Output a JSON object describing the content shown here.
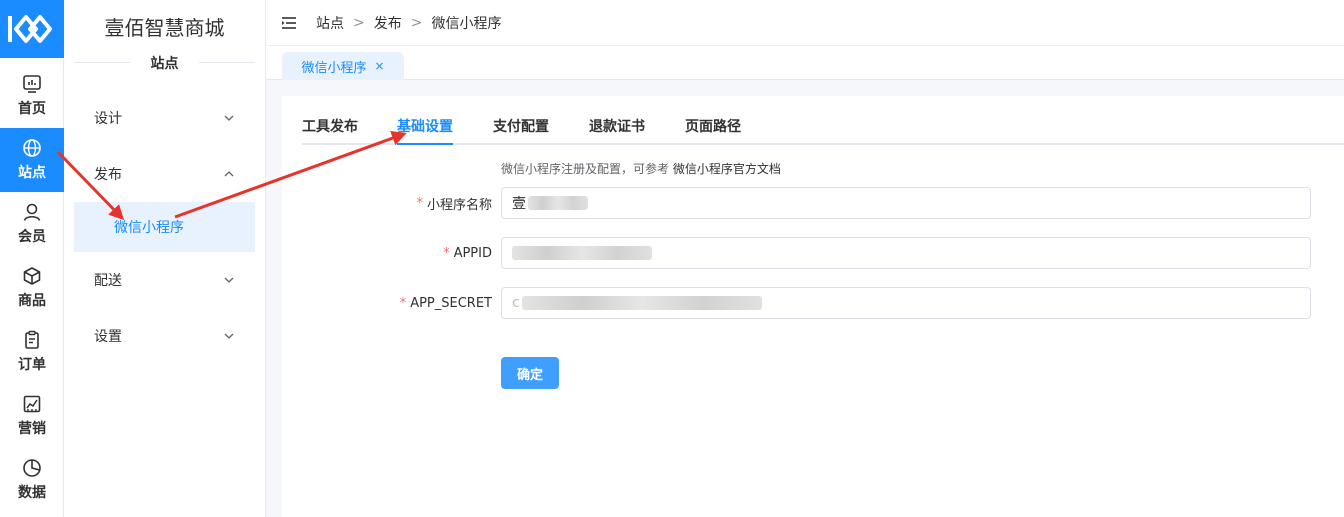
{
  "rail": {
    "items": [
      {
        "label": "首页",
        "icon": "monitor-icon"
      },
      {
        "label": "站点",
        "icon": "globe-icon"
      },
      {
        "label": "会员",
        "icon": "user-icon"
      },
      {
        "label": "商品",
        "icon": "box-icon"
      },
      {
        "label": "订单",
        "icon": "clipboard-icon"
      },
      {
        "label": "营销",
        "icon": "chart-icon"
      },
      {
        "label": "数据",
        "icon": "pie-icon"
      }
    ],
    "active_label": "站点"
  },
  "sidebar": {
    "title": "壹佰智慧商城",
    "section": "站点",
    "menu": [
      {
        "label": "设计"
      },
      {
        "label": "发布"
      },
      {
        "label": "配送"
      },
      {
        "label": "设置"
      }
    ],
    "submenu_active": "微信小程序"
  },
  "header": {
    "breadcrumb": [
      "站点",
      "发布",
      "微信小程序"
    ],
    "separator": ">"
  },
  "page_tab": {
    "label": "微信小程序",
    "close": "×"
  },
  "tabs": [
    "工具发布",
    "基础设置",
    "支付配置",
    "退款证书",
    "页面路径"
  ],
  "active_tab": "基础设置",
  "form": {
    "hint_prefix": "微信小程序注册及配置，可参考",
    "hint_link": "微信小程序官方文档",
    "fields": [
      {
        "label": "小程序名称",
        "value": "壹",
        "required": "*"
      },
      {
        "label": "APPID",
        "value": "",
        "required": "*"
      },
      {
        "label": "APP_SECRET",
        "value": "c",
        "required": "*"
      }
    ],
    "submit": "确定"
  },
  "colors": {
    "accent": "#1a8cff",
    "button": "#409eff",
    "arrow": "#e8332a",
    "required": "#f56c6c"
  }
}
